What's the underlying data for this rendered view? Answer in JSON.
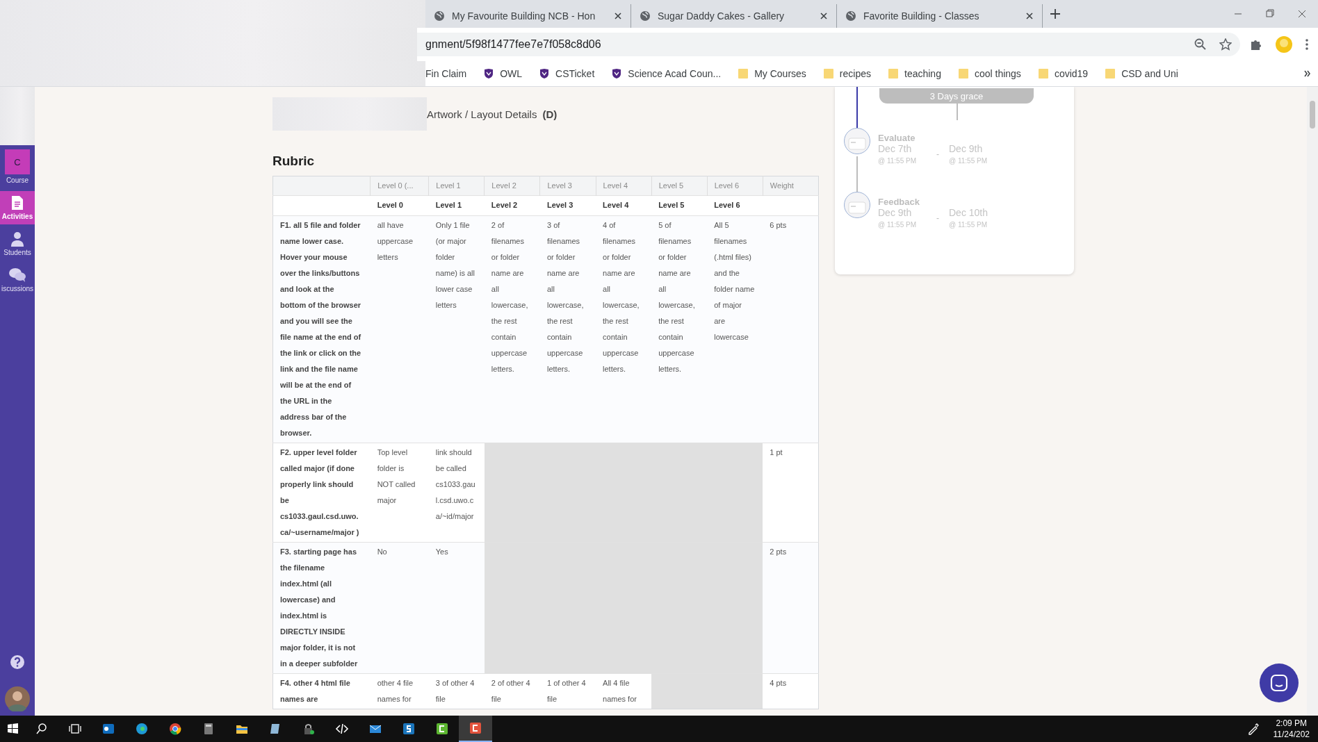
{
  "browser": {
    "tabs": [
      {
        "title": "My Favourite Building NCB - Hon"
      },
      {
        "title": "Sugar Daddy Cakes - Gallery"
      },
      {
        "title": "Favorite Building - Classes"
      }
    ],
    "url": "gnment/5f98f1477fee7e7f058c8d06",
    "bookmarks": [
      {
        "label": "Fin Claim",
        "kind": "plain"
      },
      {
        "label": "OWL",
        "kind": "shield"
      },
      {
        "label": "CSTicket",
        "kind": "shield"
      },
      {
        "label": "Science Acad Coun...",
        "kind": "shield"
      },
      {
        "label": "My Courses",
        "kind": "folder"
      },
      {
        "label": "recipes",
        "kind": "folder"
      },
      {
        "label": "teaching",
        "kind": "folder"
      },
      {
        "label": "cool things",
        "kind": "folder"
      },
      {
        "label": "covid19",
        "kind": "folder"
      },
      {
        "label": "CSD and Uni",
        "kind": "folder"
      }
    ]
  },
  "sidebar": {
    "items": [
      {
        "label": "Course",
        "kind": "letter",
        "badge": "C",
        "selected": false
      },
      {
        "label": "Activities",
        "kind": "document",
        "selected": true
      },
      {
        "label": "Students",
        "kind": "person",
        "selected": false
      },
      {
        "label": "iscussions",
        "kind": "chat",
        "selected": false
      }
    ]
  },
  "section": {
    "title": "Artwork / Layout Details",
    "code": "(D)"
  },
  "rubric": {
    "title": "Rubric",
    "columns": [
      "Level 0 (...",
      "Level 1",
      "Level 2",
      "Level 3",
      "Level 4",
      "Level 5",
      "Level 6",
      "Weight"
    ],
    "levels": [
      "Level 0",
      "Level 1",
      "Level 2",
      "Level 3",
      "Level 4",
      "Level 5",
      "Level 6"
    ],
    "rows": [
      {
        "criterion": "F1. all 5 file and folder name lower case. Hover your mouse over the links/buttons and look at the bottom of the browser and you will see the file name at the end of the link or click on the link and the file name will be at the end of the URL in the address bar of the browser.",
        "weight": "6 pts",
        "cells": [
          {
            "text": "all have uppercase letters"
          },
          {
            "text": "Only 1 file (or major folder name) is all lower case letters"
          },
          {
            "text": "2 of filenames or folder name are all lowercase, the rest contain uppercase letters."
          },
          {
            "text": "3 of filenames or folder name are all lowercase, the rest contain uppercase letters."
          },
          {
            "text": "4 of filenames or folder name are all lowercase, the rest contain uppercase letters."
          },
          {
            "text": "5 of filenames or folder name are all lowercase, the rest contain uppercase letters."
          },
          {
            "text": "All 5 filenames (.html files) and the folder name of major are lowercase"
          }
        ]
      },
      {
        "criterion": "F2. upper level folder called major (if done properly link should be cs1033.gaul.csd.uwo.ca/~username/major )",
        "weight": "1 pt",
        "cells": [
          {
            "text": "Top level folder is NOT called major"
          },
          {
            "text": "link should be called cs1033.gaul.csd.uwo.ca/~id/major"
          },
          {
            "blocked": true
          },
          {
            "blocked": true
          },
          {
            "blocked": true
          },
          {
            "blocked": true
          },
          {
            "blocked": true
          }
        ]
      },
      {
        "criterion": "F3. starting page has the filename index.html (all lowercase) and index.html is DIRECTLY INSIDE major folder, it is not in a deeper subfolder",
        "weight": "2 pts",
        "cells": [
          {
            "text": "No"
          },
          {
            "text": "Yes"
          },
          {
            "blocked": true
          },
          {
            "blocked": true
          },
          {
            "blocked": true
          },
          {
            "blocked": true
          },
          {
            "blocked": true
          }
        ]
      },
      {
        "criterion": "F4. other 4 html file names are",
        "weight": "4 pts",
        "cells": [
          {
            "text": "other 4 file names for"
          },
          {
            "text": "3 of other 4 file"
          },
          {
            "text": "2 of other 4 file"
          },
          {
            "text": "1 of other 4 file"
          },
          {
            "text": "All 4 file names for"
          },
          {
            "blocked": true
          },
          {
            "blocked": true
          }
        ]
      }
    ]
  },
  "timeline": {
    "grace": "3 Days grace",
    "steps": [
      {
        "name": "Evaluate",
        "start": "Dec 7th",
        "start_time": "@ 11:55 PM",
        "separator": "-",
        "end": "Dec 9th",
        "end_time": "@ 11:55 PM"
      },
      {
        "name": "Feedback",
        "start": "Dec 9th",
        "start_time": "@ 11:55 PM",
        "separator": "-",
        "end": "Dec 10th",
        "end_time": "@ 11:55 PM"
      }
    ]
  },
  "taskbar": {
    "time": "2:09 PM",
    "date": "11/24/202"
  }
}
